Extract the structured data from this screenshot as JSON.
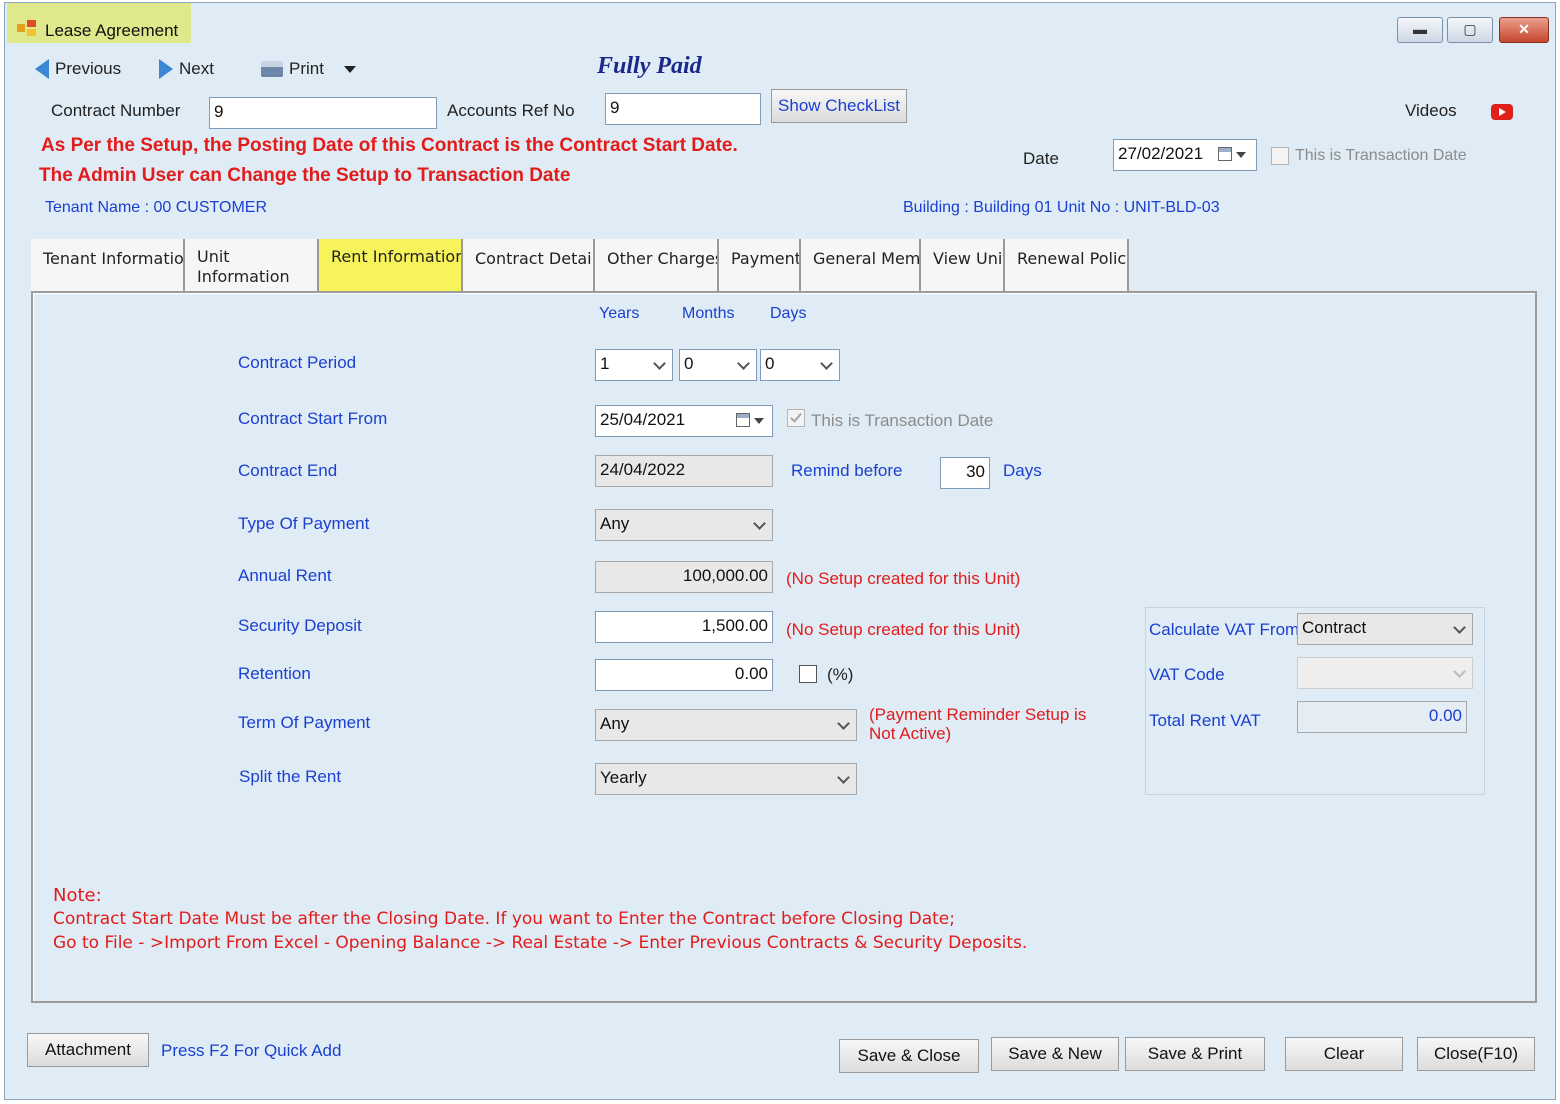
{
  "window": {
    "title": "Lease Agreement"
  },
  "toolbar": {
    "previous": "Previous",
    "next": "Next",
    "print": "Print"
  },
  "status": {
    "fully_paid": "Fully Paid"
  },
  "header": {
    "contract_number_label": "Contract Number",
    "contract_number_value": "9",
    "accounts_ref_label": "Accounts Ref No",
    "accounts_ref_value": "9",
    "show_checklist": "Show CheckList",
    "videos": "Videos",
    "warning_line1": "As Per the Setup, the Posting Date of this Contract is the Contract Start Date.",
    "warning_line2": "The Admin User can Change the Setup to Transaction Date",
    "date_label": "Date",
    "date_value": "27/02/2021",
    "transaction_date_label": "This is Transaction Date",
    "tenant_name": "Tenant Name : 00 CUSTOMER",
    "building_info": "Building : Building 01  Unit No : UNIT-BLD-03"
  },
  "tabs": [
    {
      "label": "Tenant Information"
    },
    {
      "label": "Unit Information"
    },
    {
      "label": "Rent Information"
    },
    {
      "label": "Contract Details"
    },
    {
      "label": "Other Charges"
    },
    {
      "label": "Payment"
    },
    {
      "label": "General Memo"
    },
    {
      "label": "View Unit"
    },
    {
      "label": "Renewal Policy"
    }
  ],
  "rent": {
    "col_years": "Years",
    "col_months": "Months",
    "col_days": "Days",
    "contract_period_label": "Contract Period",
    "period_years": "1",
    "period_months": "0",
    "period_days": "0",
    "start_label": "Contract Start From",
    "start_value": "25/04/2021",
    "start_transaction_label": "This is Transaction Date",
    "end_label": "Contract End",
    "end_value": "24/04/2022",
    "remind_label": "Remind before",
    "remind_value": "30",
    "remind_unit": "Days",
    "type_payment_label": "Type Of Payment",
    "type_payment_value": "Any",
    "annual_rent_label": "Annual Rent",
    "annual_rent_value": "100,000.00",
    "no_setup_1": "(No Setup created for this Unit)",
    "security_label": "Security Deposit",
    "security_value": "1,500.00",
    "no_setup_2": "(No Setup created for this Unit)",
    "retention_label": "Retention",
    "retention_value": "0.00",
    "percent_label": "(%)",
    "term_label": "Term Of Payment",
    "term_value": "Any",
    "reminder_note": "(Payment Reminder Setup is Not Active)",
    "split_label": "Split the Rent",
    "split_value": "Yearly"
  },
  "vat": {
    "calc_from_label": "Calculate VAT From",
    "calc_from_value": "Contract",
    "code_label": "VAT Code",
    "code_value": "",
    "total_label": "Total Rent VAT",
    "total_value": "0.00"
  },
  "note": {
    "title": "Note:",
    "line1": "Contract Start Date Must be after the Closing Date. If you want to Enter the Contract before Closing Date;",
    "line2": "Go to File - >Import From Excel - Opening Balance -> Real Estate -> Enter Previous Contracts & Security Deposits."
  },
  "footer": {
    "attachment": "Attachment",
    "quick_add": "Press F2 For Quick Add",
    "save_close": "Save & Close",
    "save_new": "Save & New",
    "save_print": "Save & Print",
    "clear": "Clear",
    "close": "Close(F10)"
  },
  "colors": {
    "label_blue": "#1b3fd1",
    "warning_red": "#e21b1b",
    "active_tab": "#f7f35a",
    "title_highlight": "#dfe88a",
    "background": "#dfecf5"
  }
}
